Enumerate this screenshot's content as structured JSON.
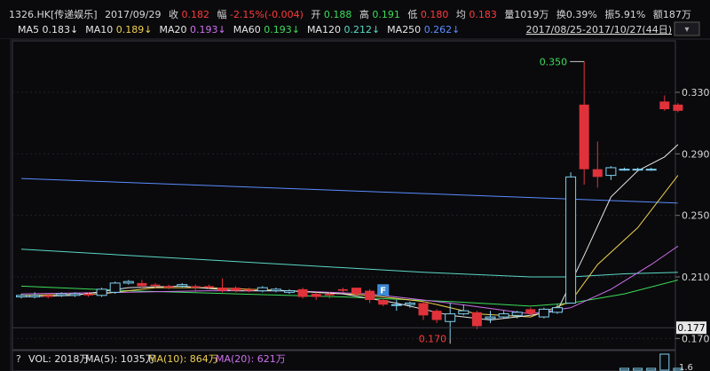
{
  "header": {
    "items": [
      {
        "label": "1326.HK[传递娱乐]",
        "color": "#d8d8d8"
      },
      {
        "label": "2017/09/29",
        "color": "#d8d8d8"
      },
      {
        "label": "收",
        "color": "#d8d8d8"
      },
      {
        "label": "0.182",
        "color": "#ff3b3b"
      },
      {
        "label": "幅",
        "color": "#d8d8d8"
      },
      {
        "label": "-2.15%(-0.004)",
        "color": "#ff3b3b"
      },
      {
        "label": "开",
        "color": "#d8d8d8"
      },
      {
        "label": "0.188",
        "color": "#3cdc5a"
      },
      {
        "label": "高",
        "color": "#d8d8d8"
      },
      {
        "label": "0.191",
        "color": "#3cdc5a"
      },
      {
        "label": "低",
        "color": "#d8d8d8"
      },
      {
        "label": "0.180",
        "color": "#ff3b3b"
      },
      {
        "label": "均",
        "color": "#d8d8d8"
      },
      {
        "label": "0.183",
        "color": "#ff3b3b"
      },
      {
        "label": "量1019万",
        "color": "#d8d8d8"
      },
      {
        "label": "换0.39%",
        "color": "#d8d8d8"
      },
      {
        "label": "振5.91%",
        "color": "#d8d8d8"
      },
      {
        "label": "额187万",
        "color": "#d8d8d8"
      }
    ]
  },
  "ma_bar": {
    "items": [
      {
        "label": "MA5",
        "value": "0.183↓",
        "color": "#e6e6e6"
      },
      {
        "label": "MA10",
        "value": "0.189↓",
        "color": "#f0d050"
      },
      {
        "label": "MA20",
        "value": "0.193↓",
        "color": "#d070f0"
      },
      {
        "label": "MA60",
        "value": "0.193↓",
        "color": "#3cdc5a"
      },
      {
        "label": "MA120",
        "value": "0.212↓",
        "color": "#5ad8c8"
      },
      {
        "label": "MA250",
        "value": "0.262↓",
        "color": "#5a8cff"
      }
    ],
    "range": "2017/08/25-2017/10/27(44日)"
  },
  "markers": {
    "high_label": "0.350",
    "low_label": "0.170",
    "f_label": "F",
    "current_price": "0.177"
  },
  "volume_bar": {
    "question": "?",
    "vol": "VOL: 2018万",
    "ma5": "MA(5): 1035万",
    "ma10": "MA(10): 864万",
    "ma20": "MA(20): 621万"
  },
  "axis_bottom_partial": "1.6",
  "chart_data": {
    "type": "candlestick",
    "ylim": [
      0.165,
      0.36
    ],
    "y_ticks": [
      0.33,
      0.29,
      0.25,
      0.21,
      0.17
    ],
    "y_tick_labels": [
      "0.330",
      "0.290",
      "0.250",
      "0.210",
      "0.170"
    ],
    "candles": [
      {
        "o": 0.197,
        "c": 0.198,
        "h": 0.199,
        "l": 0.196
      },
      {
        "o": 0.197,
        "c": 0.198,
        "h": 0.2,
        "l": 0.196
      },
      {
        "o": 0.198,
        "c": 0.197,
        "h": 0.199,
        "l": 0.196
      },
      {
        "o": 0.198,
        "c": 0.199,
        "h": 0.2,
        "l": 0.197
      },
      {
        "o": 0.198,
        "c": 0.199,
        "h": 0.2,
        "l": 0.197
      },
      {
        "o": 0.199,
        "c": 0.198,
        "h": 0.2,
        "l": 0.197
      },
      {
        "o": 0.198,
        "c": 0.202,
        "h": 0.203,
        "l": 0.197
      },
      {
        "o": 0.2,
        "c": 0.206,
        "h": 0.207,
        "l": 0.199
      },
      {
        "o": 0.206,
        "c": 0.207,
        "h": 0.208,
        "l": 0.205
      },
      {
        "o": 0.206,
        "c": 0.204,
        "h": 0.208,
        "l": 0.203
      },
      {
        "o": 0.205,
        "c": 0.204,
        "h": 0.206,
        "l": 0.203
      },
      {
        "o": 0.204,
        "c": 0.203,
        "h": 0.205,
        "l": 0.202
      },
      {
        "o": 0.204,
        "c": 0.205,
        "h": 0.206,
        "l": 0.203
      },
      {
        "o": 0.204,
        "c": 0.203,
        "h": 0.205,
        "l": 0.2
      },
      {
        "o": 0.204,
        "c": 0.203,
        "h": 0.205,
        "l": 0.202
      },
      {
        "o": 0.203,
        "c": 0.201,
        "h": 0.209,
        "l": 0.2
      },
      {
        "o": 0.203,
        "c": 0.201,
        "h": 0.204,
        "l": 0.2
      },
      {
        "o": 0.202,
        "c": 0.201,
        "h": 0.203,
        "l": 0.2
      },
      {
        "o": 0.201,
        "c": 0.203,
        "h": 0.204,
        "l": 0.2
      },
      {
        "o": 0.201,
        "c": 0.202,
        "h": 0.203,
        "l": 0.2
      },
      {
        "o": 0.2,
        "c": 0.201,
        "h": 0.202,
        "l": 0.199
      },
      {
        "o": 0.202,
        "c": 0.197,
        "h": 0.203,
        "l": 0.196
      },
      {
        "o": 0.199,
        "c": 0.197,
        "h": 0.2,
        "l": 0.195
      },
      {
        "o": 0.199,
        "c": 0.198,
        "h": 0.2,
        "l": 0.196
      },
      {
        "o": 0.202,
        "c": 0.201,
        "h": 0.203,
        "l": 0.2
      },
      {
        "o": 0.203,
        "c": 0.199,
        "h": 0.203,
        "l": 0.198
      },
      {
        "o": 0.201,
        "c": 0.195,
        "h": 0.202,
        "l": 0.193
      },
      {
        "o": 0.195,
        "c": 0.192,
        "h": 0.196,
        "l": 0.191
      },
      {
        "o": 0.192,
        "c": 0.192,
        "h": 0.195,
        "l": 0.188
      },
      {
        "o": 0.192,
        "c": 0.193,
        "h": 0.194,
        "l": 0.19
      },
      {
        "o": 0.193,
        "c": 0.185,
        "h": 0.194,
        "l": 0.182
      },
      {
        "o": 0.188,
        "c": 0.182,
        "h": 0.189,
        "l": 0.18
      },
      {
        "o": 0.181,
        "c": 0.186,
        "h": 0.193,
        "l": 0.17
      },
      {
        "o": 0.186,
        "c": 0.188,
        "h": 0.192,
        "l": 0.185
      },
      {
        "o": 0.187,
        "c": 0.178,
        "h": 0.188,
        "l": 0.176
      },
      {
        "o": 0.183,
        "c": 0.184,
        "h": 0.188,
        "l": 0.18
      },
      {
        "o": 0.184,
        "c": 0.186,
        "h": 0.188,
        "l": 0.183
      },
      {
        "o": 0.185,
        "c": 0.187,
        "h": 0.188,
        "l": 0.183
      },
      {
        "o": 0.189,
        "c": 0.186,
        "h": 0.19,
        "l": 0.185
      },
      {
        "o": 0.184,
        "c": 0.189,
        "h": 0.19,
        "l": 0.183
      },
      {
        "o": 0.187,
        "c": 0.19,
        "h": 0.192,
        "l": 0.186
      },
      {
        "o": 0.193,
        "c": 0.275,
        "h": 0.278,
        "l": 0.193
      },
      {
        "o": 0.322,
        "c": 0.28,
        "h": 0.35,
        "l": 0.27
      },
      {
        "o": 0.28,
        "c": 0.275,
        "h": 0.298,
        "l": 0.268
      },
      {
        "o": 0.276,
        "c": 0.281,
        "h": 0.282,
        "l": 0.273
      },
      {
        "o": 0.28,
        "c": 0.28,
        "h": 0.281,
        "l": 0.279
      },
      {
        "o": 0.28,
        "c": 0.28,
        "h": 0.281,
        "l": 0.279
      },
      {
        "o": 0.28,
        "c": 0.28,
        "h": 0.281,
        "l": 0.279
      },
      {
        "o": 0.324,
        "c": 0.319,
        "h": 0.328,
        "l": 0.318
      },
      {
        "o": 0.322,
        "c": 0.318,
        "h": 0.323,
        "l": 0.317
      }
    ],
    "ma_lines": [
      {
        "name": "MA250",
        "color": "#5a8cff",
        "points": [
          [
            0,
            0.274
          ],
          [
            49,
            0.258
          ]
        ]
      },
      {
        "name": "MA120",
        "color": "#5ad8c8",
        "points": [
          [
            0,
            0.228
          ],
          [
            10,
            0.223
          ],
          [
            20,
            0.218
          ],
          [
            30,
            0.213
          ],
          [
            38,
            0.21
          ],
          [
            41,
            0.21
          ],
          [
            45,
            0.212
          ],
          [
            49,
            0.213
          ]
        ]
      },
      {
        "name": "MA60",
        "color": "#3cdc5a",
        "points": [
          [
            0,
            0.204
          ],
          [
            8,
            0.201
          ],
          [
            16,
            0.199
          ],
          [
            24,
            0.197
          ],
          [
            32,
            0.194
          ],
          [
            38,
            0.191
          ],
          [
            41,
            0.193
          ],
          [
            45,
            0.199
          ],
          [
            49,
            0.208
          ]
        ]
      },
      {
        "name": "MA20",
        "color": "#d070f0",
        "points": [
          [
            0,
            0.199
          ],
          [
            8,
            0.2
          ],
          [
            14,
            0.201
          ],
          [
            20,
            0.201
          ],
          [
            26,
            0.199
          ],
          [
            32,
            0.193
          ],
          [
            38,
            0.186
          ],
          [
            41,
            0.19
          ],
          [
            44,
            0.202
          ],
          [
            47,
            0.218
          ],
          [
            49,
            0.23
          ]
        ]
      },
      {
        "name": "MA10",
        "color": "#f0d050",
        "points": [
          [
            0,
            0.198
          ],
          [
            6,
            0.199
          ],
          [
            10,
            0.203
          ],
          [
            14,
            0.203
          ],
          [
            20,
            0.201
          ],
          [
            26,
            0.198
          ],
          [
            30,
            0.194
          ],
          [
            34,
            0.186
          ],
          [
            38,
            0.184
          ],
          [
            41,
            0.194
          ],
          [
            43,
            0.218
          ],
          [
            46,
            0.242
          ],
          [
            49,
            0.276
          ]
        ]
      },
      {
        "name": "MA5",
        "color": "#e6e6e6",
        "points": [
          [
            0,
            0.197
          ],
          [
            4,
            0.198
          ],
          [
            8,
            0.203
          ],
          [
            12,
            0.204
          ],
          [
            16,
            0.201
          ],
          [
            20,
            0.201
          ],
          [
            24,
            0.199
          ],
          [
            28,
            0.193
          ],
          [
            32,
            0.185
          ],
          [
            35,
            0.182
          ],
          [
            38,
            0.185
          ],
          [
            40,
            0.188
          ],
          [
            42,
            0.224
          ],
          [
            44,
            0.262
          ],
          [
            46,
            0.279
          ],
          [
            48,
            0.288
          ],
          [
            49,
            0.296
          ]
        ]
      }
    ],
    "volumes": [
      3,
      2,
      2,
      2,
      2,
      2,
      2,
      2,
      2,
      2,
      2,
      2,
      2,
      2,
      2,
      2,
      2,
      2,
      2,
      2,
      2,
      2,
      2,
      2,
      2,
      2,
      2,
      2,
      2,
      2,
      2,
      2,
      2,
      2,
      2,
      2,
      2,
      2,
      2,
      2,
      2,
      2,
      2,
      2,
      2,
      2,
      2,
      2,
      18,
      2
    ]
  }
}
